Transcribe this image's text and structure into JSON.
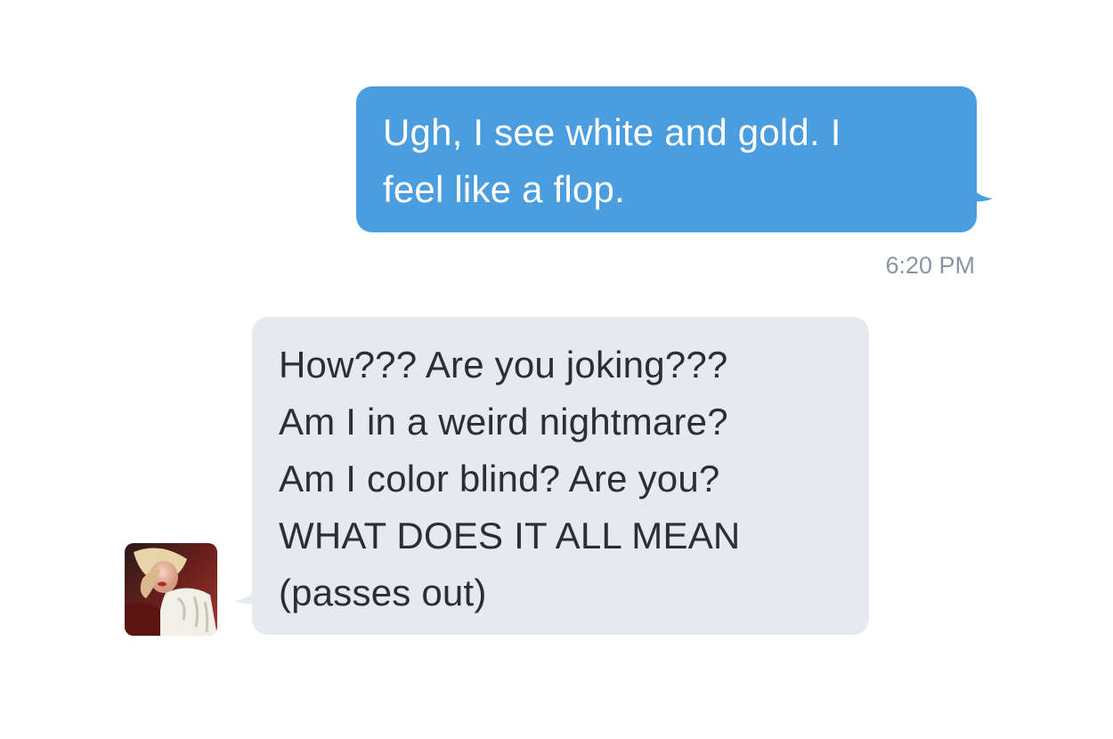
{
  "conversation": {
    "sent": {
      "lines": [
        "Ugh, I see white and gold. I",
        "feel like a flop."
      ],
      "time": "6:20 PM",
      "color": "#4a9ee0"
    },
    "received": {
      "lines": [
        "How??? Are you joking???",
        "Am I in a weird nightmare?",
        "Am I color blind? Are you?",
        "WHAT DOES IT ALL MEAN",
        "(passes out)"
      ],
      "color": "#e6e9ed"
    },
    "avatar_icon": "user-avatar-photo"
  }
}
